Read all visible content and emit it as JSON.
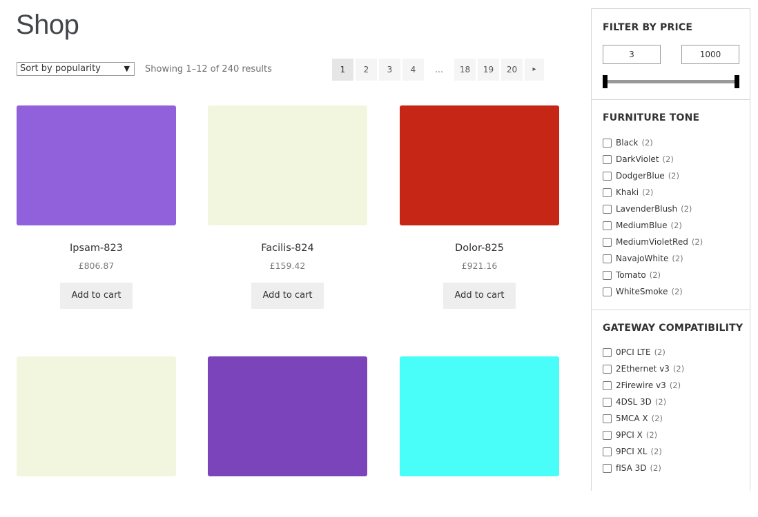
{
  "page": {
    "title": "Shop"
  },
  "toolbar": {
    "sort_selected": "Sort by popularity",
    "result_count": "Showing 1–12 of 240 results"
  },
  "pagination": {
    "pages": [
      "1",
      "2",
      "3",
      "4",
      "…",
      "18",
      "19",
      "20"
    ],
    "current": "1",
    "next_icon": "▸"
  },
  "products": [
    {
      "name": "Ipsam-823",
      "price": "£806.87",
      "color": "#9061db",
      "button": "Add to cart"
    },
    {
      "name": "Facilis-824",
      "price": "£159.42",
      "color": "#f3f6de",
      "button": "Add to cart"
    },
    {
      "name": "Dolor-825",
      "price": "£921.16",
      "color": "#c62615",
      "button": "Add to cart"
    },
    {
      "name": "",
      "price": "",
      "color": "#f3f6de",
      "button": ""
    },
    {
      "name": "",
      "price": "",
      "color": "#7b44bb",
      "button": ""
    },
    {
      "name": "",
      "price": "",
      "color": "#49fef8",
      "button": ""
    }
  ],
  "sidebar": {
    "price_filter": {
      "title": "FILTER BY PRICE",
      "min": "3",
      "max": "1000"
    },
    "tone_filter": {
      "title": "FURNITURE TONE",
      "items": [
        {
          "label": "Black",
          "count": "(2)"
        },
        {
          "label": "DarkViolet",
          "count": "(2)"
        },
        {
          "label": "DodgerBlue",
          "count": "(2)"
        },
        {
          "label": "Khaki",
          "count": "(2)"
        },
        {
          "label": "LavenderBlush",
          "count": "(2)"
        },
        {
          "label": "MediumBlue",
          "count": "(2)"
        },
        {
          "label": "MediumVioletRed",
          "count": "(2)"
        },
        {
          "label": "NavajoWhite",
          "count": "(2)"
        },
        {
          "label": "Tomato",
          "count": "(2)"
        },
        {
          "label": "WhiteSmoke",
          "count": "(2)"
        }
      ]
    },
    "gateway_filter": {
      "title": "GATEWAY COMPATIBILITY",
      "items": [
        {
          "label": "0PCI LTE",
          "count": "(2)"
        },
        {
          "label": "2Ethernet v3",
          "count": "(2)"
        },
        {
          "label": "2Firewire v3",
          "count": "(2)"
        },
        {
          "label": "4DSL 3D",
          "count": "(2)"
        },
        {
          "label": "5MCA X",
          "count": "(2)"
        },
        {
          "label": "9PCI X",
          "count": "(2)"
        },
        {
          "label": "9PCI XL",
          "count": "(2)"
        },
        {
          "label": "fISA 3D",
          "count": "(2)"
        }
      ]
    }
  }
}
